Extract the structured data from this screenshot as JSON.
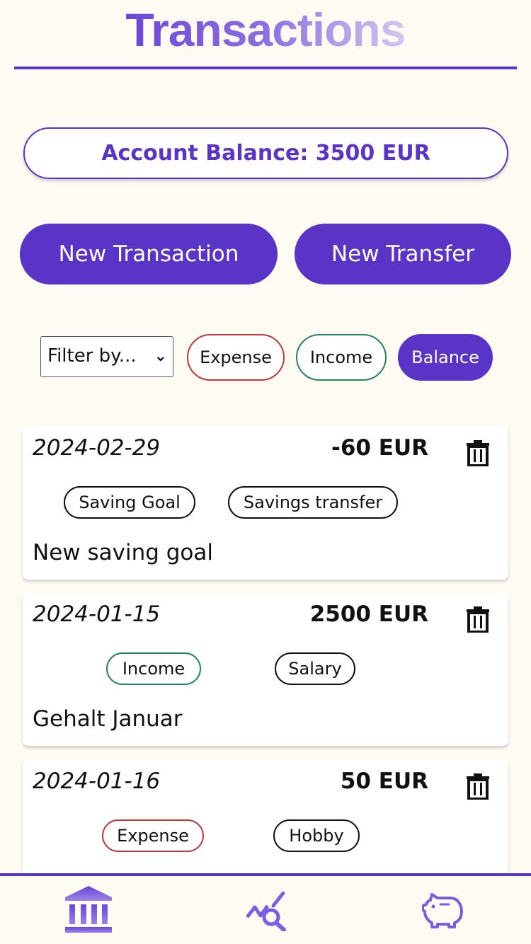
{
  "header": {
    "title": "Transactions"
  },
  "balance": {
    "label": "Account Balance: 3500 EUR"
  },
  "actions": {
    "new_transaction": "New Transaction",
    "new_transfer": "New Transfer"
  },
  "filter": {
    "select_label": "Filter by...",
    "chips": [
      "Expense",
      "Income",
      "Balance"
    ],
    "active": "Balance"
  },
  "transactions": [
    {
      "date": "2024-02-29",
      "amount": "-60 EUR",
      "tags": [
        "Saving Goal",
        "Savings transfer"
      ],
      "description": "New saving goal"
    },
    {
      "date": "2024-01-15",
      "amount": "2500 EUR",
      "tags": [
        "Income",
        "Salary"
      ],
      "description": "Gehalt Januar"
    },
    {
      "date": "2024-01-16",
      "amount": "50 EUR",
      "tags": [
        "Expense",
        "Hobby"
      ],
      "description": ""
    }
  ],
  "nav": {
    "items": [
      {
        "icon": "bank-icon",
        "active": true
      },
      {
        "icon": "chart-search-icon",
        "active": false
      },
      {
        "icon": "piggy-bank-icon",
        "active": false
      }
    ]
  },
  "colors": {
    "accent": "#5a33c7",
    "expense": "#c0393b",
    "income": "#23845f",
    "background": "#fefbf3"
  }
}
